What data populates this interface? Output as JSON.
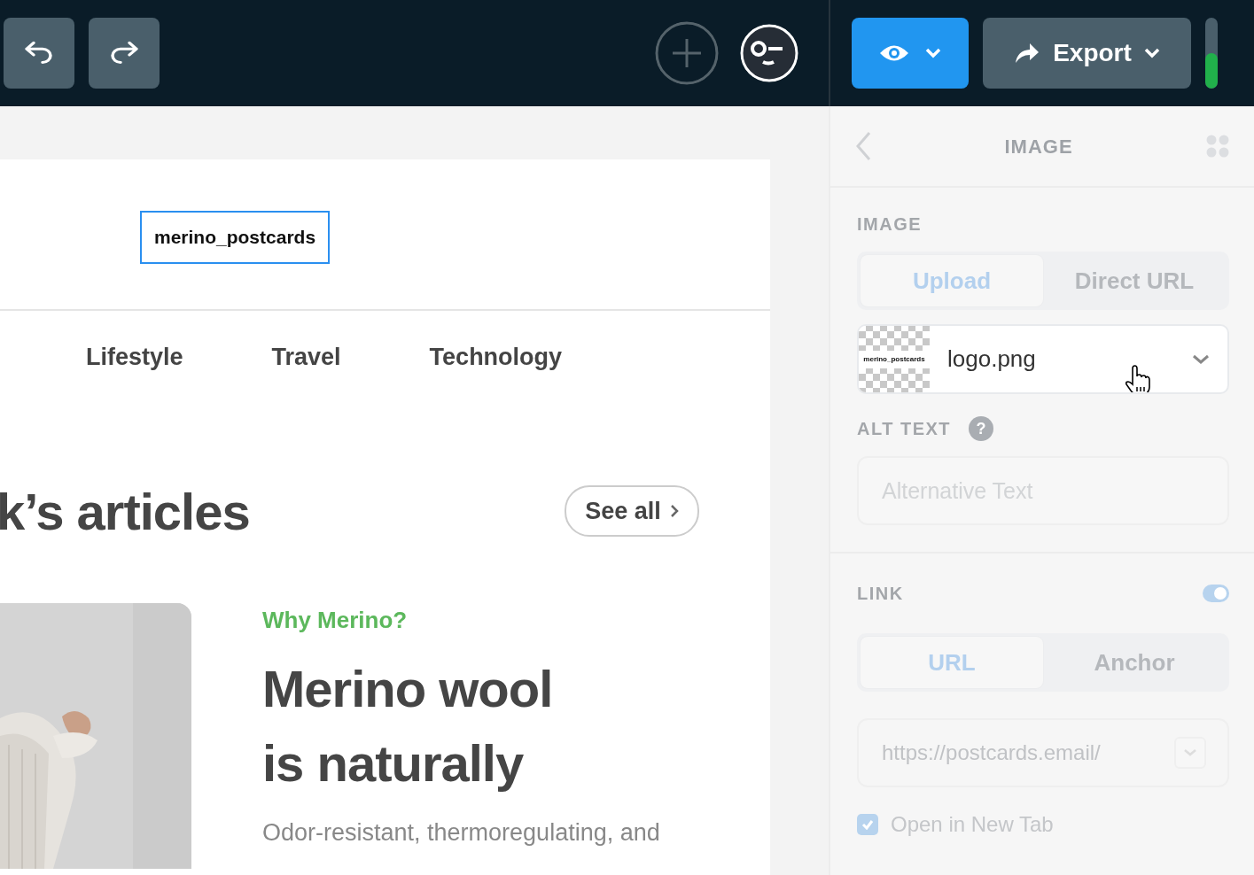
{
  "toolbar": {
    "export_label": "Export",
    "meter": {
      "level": 0.5
    }
  },
  "canvas": {
    "logo_text": "merino_postcards",
    "nav": [
      "Lifestyle",
      "Travel",
      "Technology"
    ],
    "heading": "k’s articles",
    "see_all": "See all",
    "article": {
      "kind": "picture",
      "category": "Why Merino?",
      "title_lines": [
        "Merino wool",
        "is naturally"
      ],
      "excerpt": "Odor-resistant, thermoregulating, and"
    }
  },
  "panel": {
    "title": "IMAGE",
    "image": {
      "label": "IMAGE",
      "tabs": [
        {
          "label": "Upload",
          "selected": true
        },
        {
          "label": "Direct URL",
          "selected": false
        }
      ],
      "file": {
        "name": "logo.png",
        "thumb_text": "merino_postcards"
      }
    },
    "alt": {
      "label": "ALT TEXT",
      "help": "?",
      "placeholder": "Alternative Text"
    },
    "link": {
      "label": "LINK",
      "on": true,
      "tabs": [
        {
          "label": "URL",
          "selected": true
        },
        {
          "label": "Anchor",
          "selected": false
        }
      ],
      "url": "https://postcards.email/",
      "new_tab": {
        "label": "Open in New Tab",
        "checked": true
      }
    }
  }
}
